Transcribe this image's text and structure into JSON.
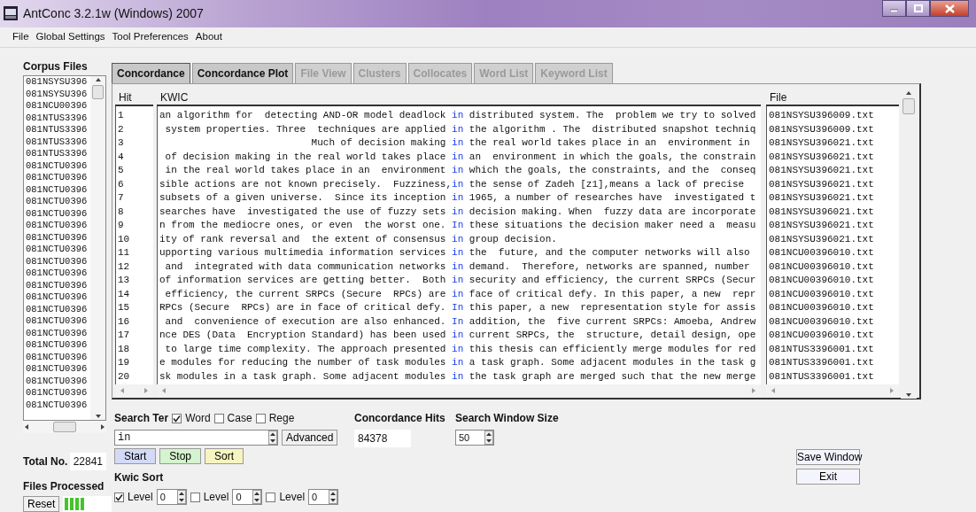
{
  "window": {
    "title": "AntConc 3.2.1w (Windows) 2007"
  },
  "menu": [
    "File",
    "Global Settings",
    "Tool Preferences",
    "About"
  ],
  "corpus_files": {
    "label": "Corpus Files",
    "items": [
      "081NSYSU396",
      "081NSYSU396",
      "081NCU00396",
      "081NTUS3396",
      "081NTUS3396",
      "081NTUS3396",
      "081NTUS3396",
      "081NCTU0396",
      "081NCTU0396",
      "081NCTU0396",
      "081NCTU0396",
      "081NCTU0396",
      "081NCTU0396",
      "081NCTU0396",
      "081NCTU0396",
      "081NCTU0396",
      "081NCTU0396",
      "081NCTU0396",
      "081NCTU0396",
      "081NCTU0396",
      "081NCTU0396",
      "081NCTU0396",
      "081NCTU0396",
      "081NCTU0396",
      "081NCTU0396",
      "081NCTU0396",
      "081NCTU0396",
      "081NCTU0396"
    ]
  },
  "tabs": [
    {
      "label": "Concordance",
      "selected": true,
      "disabled": false
    },
    {
      "label": "Concordance Plot",
      "selected": false,
      "disabled": false
    },
    {
      "label": "File View",
      "selected": false,
      "disabled": true
    },
    {
      "label": "Clusters",
      "selected": false,
      "disabled": true
    },
    {
      "label": "Collocates",
      "selected": false,
      "disabled": true
    },
    {
      "label": "Word List",
      "selected": false,
      "disabled": true
    },
    {
      "label": "Keyword List",
      "selected": false,
      "disabled": true
    }
  ],
  "concordance": {
    "columns": [
      "Hit",
      "KWIC",
      "File"
    ],
    "rows": [
      {
        "hit": "1",
        "left": "an algorithm for  detecting AND-OR model deadlock ",
        "keyword": "in",
        "right": " distributed system. The  problem we try to solved",
        "file": "081NSYSU396009.txt"
      },
      {
        "hit": "2",
        "left": "system properties. Three  techniques are applied ",
        "keyword": "in",
        "right": " the algorithm . The  distributed snapshot techniq",
        "file": "081NSYSU396009.txt"
      },
      {
        "hit": "3",
        "left": "Much of decision making ",
        "keyword": "in",
        "right": " the real world takes place in an  environment in",
        "file": "081NSYSU396021.txt"
      },
      {
        "hit": "4",
        "left": "of decision making in the real world takes place ",
        "keyword": "in",
        "right": " an  environment in which the goals, the constrain",
        "file": "081NSYSU396021.txt"
      },
      {
        "hit": "5",
        "left": "in the real world takes place in an  environment ",
        "keyword": "in",
        "right": " which the goals, the constraints, and the  conseq",
        "file": "081NSYSU396021.txt"
      },
      {
        "hit": "6",
        "left": "sible actions are not known precisely.  Fuzziness,",
        "keyword": "in",
        "right": " the sense of Zadeh [z1],means a lack of precise",
        "file": "081NSYSU396021.txt"
      },
      {
        "hit": "7",
        "left": "subsets of a given universe.  Since its inception ",
        "keyword": "in",
        "right": " 1965, a number of researches have  investigated t",
        "file": "081NSYSU396021.txt"
      },
      {
        "hit": "8",
        "left": "searches have  investigated the use of fuzzy sets ",
        "keyword": "in",
        "right": " decision making. When  fuzzy data are incorporate",
        "file": "081NSYSU396021.txt"
      },
      {
        "hit": "9",
        "left": "n from the mediocre ones, or even  the worst one. ",
        "keyword": "In",
        "right": " these situations the decision maker need a  measu",
        "file": "081NSYSU396021.txt"
      },
      {
        "hit": "10",
        "left": "ity of rank reversal and  the extent of consensus ",
        "keyword": "in",
        "right": " group decision.",
        "file": "081NSYSU396021.txt"
      },
      {
        "hit": "11",
        "left": "upporting various multimedia information services ",
        "keyword": "in",
        "right": " the  future, and the computer networks will also",
        "file": "081NCU00396010.txt"
      },
      {
        "hit": "12",
        "left": "and  integrated with data communication networks ",
        "keyword": "in",
        "right": " demand.  Therefore, networks are spanned, number",
        "file": "081NCU00396010.txt"
      },
      {
        "hit": "13",
        "left": "of information services are getting better.  Both ",
        "keyword": "in",
        "right": " security and efficiency, the current SRPCs (Secur",
        "file": "081NCU00396010.txt"
      },
      {
        "hit": "14",
        "left": "efficiency, the current SRPCs (Secure  RPCs) are ",
        "keyword": "in",
        "right": " face of critical defy. In this paper, a new  repr",
        "file": "081NCU00396010.txt"
      },
      {
        "hit": "15",
        "left": "RPCs (Secure  RPCs) are in face of critical defy. ",
        "keyword": "In",
        "right": " this paper, a new  representation style for assis",
        "file": "081NCU00396010.txt"
      },
      {
        "hit": "16",
        "left": "and  convenience of execution are also enhanced. ",
        "keyword": "In",
        "right": " addition, the  five current SRPCs: Amoeba, Andrew",
        "file": "081NCU00396010.txt"
      },
      {
        "hit": "17",
        "left": "nce DES (Data  Encryption Standard) has been used ",
        "keyword": "in",
        "right": " current SRPCs, the  structure, detail design, ope",
        "file": "081NCU00396010.txt"
      },
      {
        "hit": "18",
        "left": "to large time complexity. The approach presented ",
        "keyword": "in",
        "right": " this thesis can efficiently merge modules for red",
        "file": "081NTUS3396001.txt"
      },
      {
        "hit": "19",
        "left": "e modules for reducing the number of task modules ",
        "keyword": "in",
        "right": " a task graph. Some adjacent modules in the task g",
        "file": "081NTUS3396001.txt"
      },
      {
        "hit": "20",
        "left": "sk modules in a task graph. Some adjacent modules ",
        "keyword": "in",
        "right": " the task graph are merged such that the new merge",
        "file": "081NTUS3396001.txt"
      }
    ]
  },
  "search": {
    "label": "Search Ter",
    "options": [
      {
        "label": "Word",
        "checked": true
      },
      {
        "label": "Case",
        "checked": false
      },
      {
        "label": "Rege",
        "checked": false
      }
    ],
    "term": "in",
    "advanced_button": "Advanced",
    "start_button": "Start",
    "stop_button": "Stop",
    "sort_button": "Sort"
  },
  "hits": {
    "label": "Concordance Hits",
    "value": "84378"
  },
  "window_size": {
    "label": "Search Window Size",
    "value": "50"
  },
  "kwic_sort": {
    "label": "Kwic Sort",
    "levels": [
      {
        "label": "Level",
        "checked": true,
        "value": "0"
      },
      {
        "label": "Level",
        "checked": false,
        "value": "0"
      },
      {
        "label": "Level",
        "checked": false,
        "value": "0"
      }
    ]
  },
  "total": {
    "label": "Total No.",
    "value": "22841"
  },
  "files_processed": {
    "label": "Files Processed",
    "level": 0.42,
    "reset_button": "Reset"
  },
  "buttons": [
    "Save Window",
    "Exit"
  ]
}
